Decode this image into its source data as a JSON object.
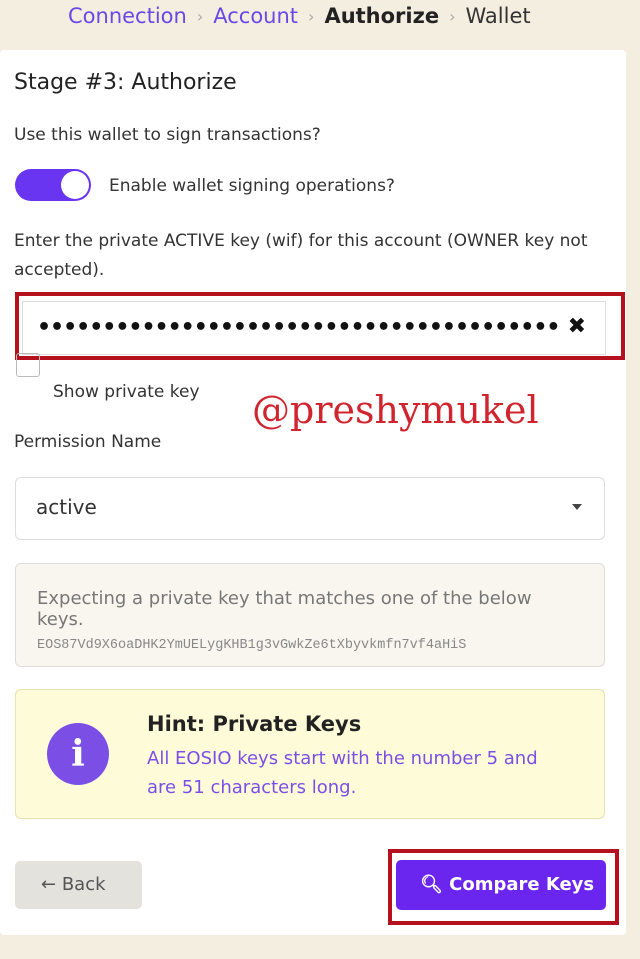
{
  "breadcrumb": {
    "items": [
      "Connection",
      "Account",
      "Authorize",
      "Wallet"
    ]
  },
  "stage_title": "Stage #3: Authorize",
  "sign_question": "Use this wallet to sign transactions?",
  "toggle": {
    "label": "Enable wallet signing operations?",
    "on": true
  },
  "key_prompt": "Enter the private ACTIVE key (wif) for this account (OWNER key not accepted).",
  "key_input": {
    "value": "••••••••••••••••••••••••••••••••••••••••",
    "clear": "✖"
  },
  "show_key": {
    "label": "Show private key",
    "checked": false
  },
  "watermark": "@preshymukel",
  "permission": {
    "label": "Permission Name",
    "selected": "active"
  },
  "expect": {
    "text": "Expecting a private key that matches one of the below keys.",
    "key": "EOS87Vd9X6oaDHK2YmUELygKHB1g3vGwkZe6tXbyvkmfn7vf4aHiS"
  },
  "hint": {
    "title": "Hint: Private Keys",
    "body": "All EOSIO keys start with the number 5 and are 51 characters long."
  },
  "buttons": {
    "back": "Back",
    "compare": "Compare Keys"
  },
  "colors": {
    "accent": "#6a35f0",
    "highlight": "#b4101e"
  }
}
